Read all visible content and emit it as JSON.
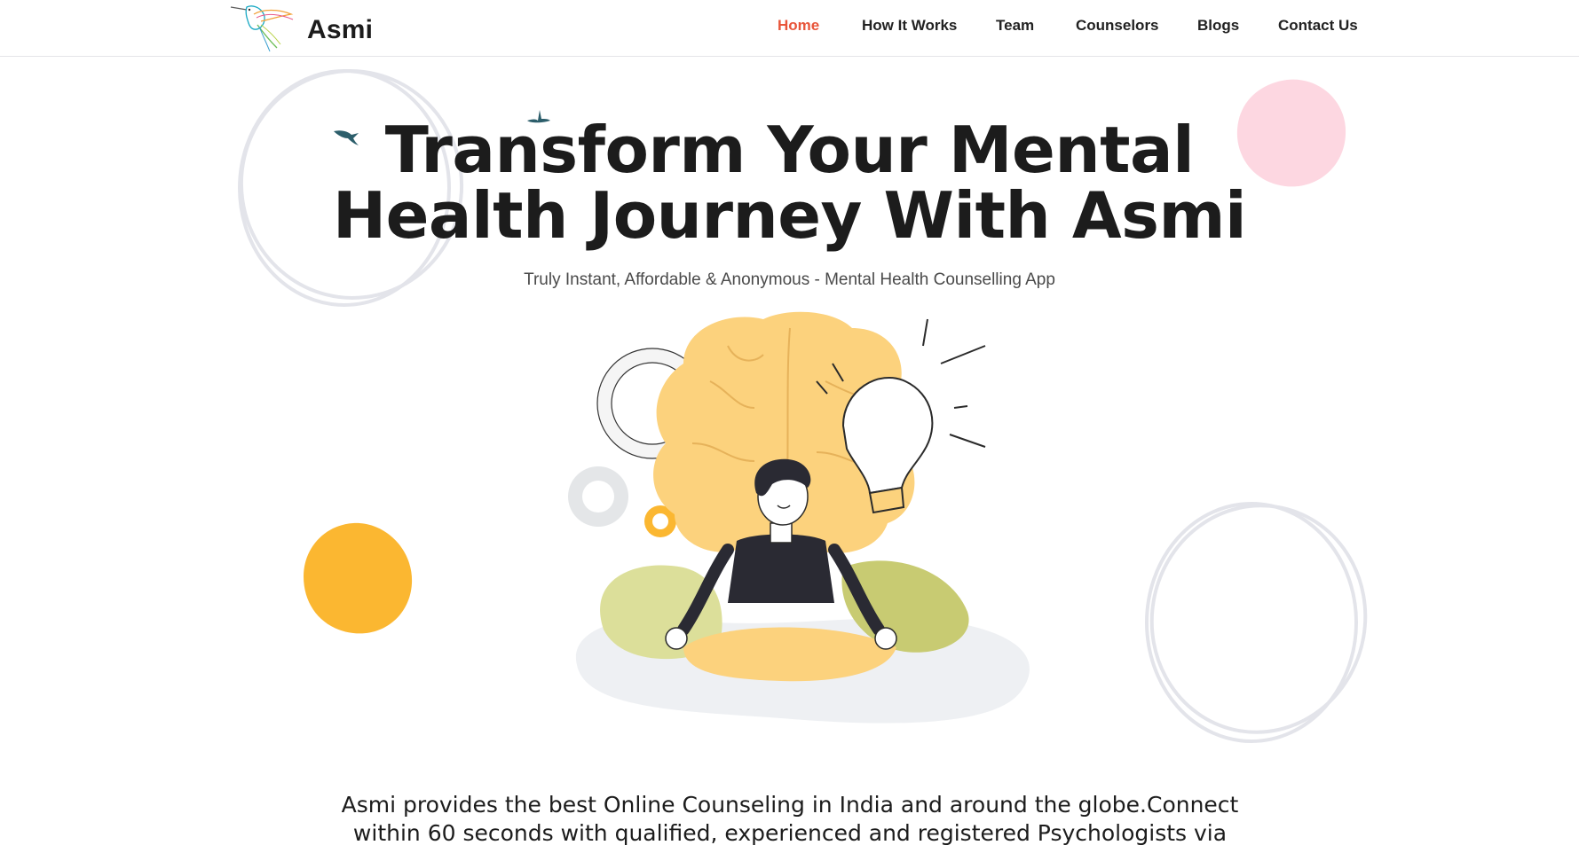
{
  "brand": {
    "name": "Asmi",
    "logo_icon": "hummingbird-icon"
  },
  "nav": {
    "items": [
      {
        "label": "Home",
        "active": true
      },
      {
        "label": "How It Works",
        "active": false
      },
      {
        "label": "Team",
        "active": false
      },
      {
        "label": "Counselors",
        "active": false
      },
      {
        "label": "Blogs",
        "active": false
      },
      {
        "label": "Contact Us",
        "active": false
      }
    ]
  },
  "hero": {
    "title_line1": "Transform Your Mental",
    "title_line2": "Health Journey With Asmi",
    "subtitle": "Truly Instant, Affordable & Anonymous - Mental Health Counselling App",
    "body": "Asmi provides the best Online Counseling in India and around the globe.Connect within 60 seconds with qualified, experienced and registered Psychologists via",
    "illustration": "meditating-person-brain-illustration"
  },
  "colors": {
    "accent": "#e8553a",
    "text": "#1c1c1c",
    "yellow_blob": "#fbb731",
    "pink_blob": "#fdd7e1",
    "brain": "#fcd27d",
    "leaf": "#c8cb72"
  }
}
